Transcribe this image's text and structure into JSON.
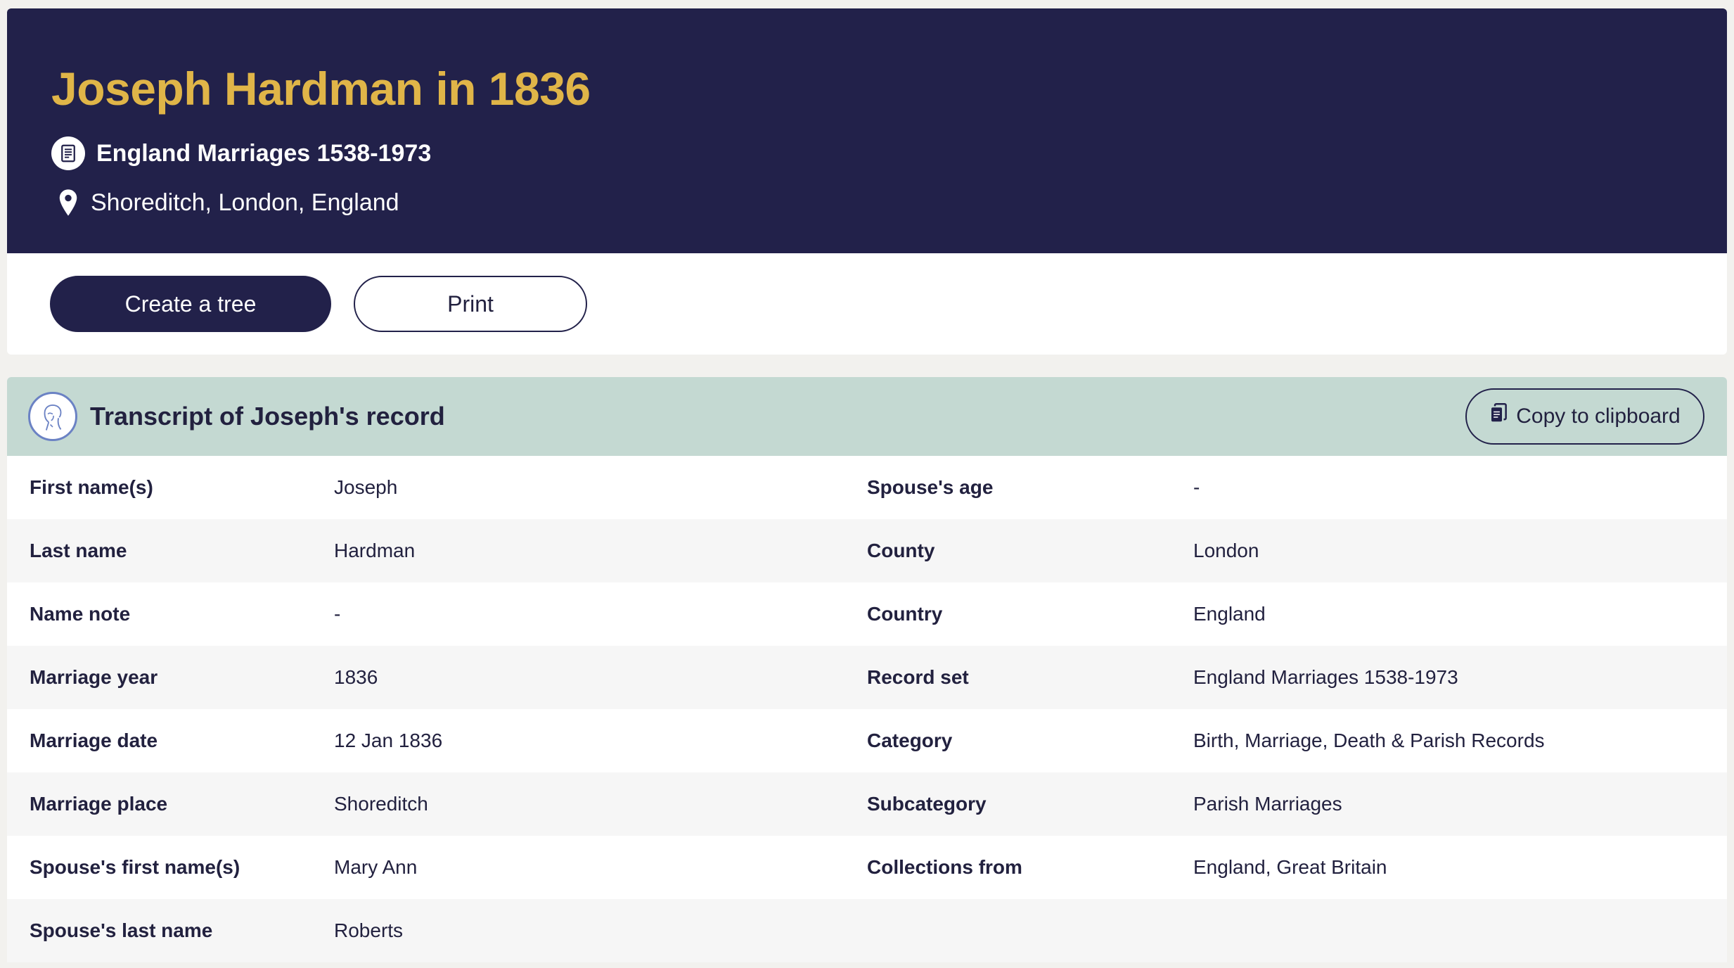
{
  "header": {
    "title": "Joseph Hardman in 1836",
    "record_set": "England Marriages 1538-1973",
    "location": "Shoreditch, London, England",
    "colors": {
      "background": "#22214a",
      "title": "#e0b548"
    }
  },
  "actions": {
    "create_tree": "Create a tree",
    "print": "Print"
  },
  "transcript": {
    "title": "Transcript of Joseph's record",
    "copy_label": "Copy to clipboard",
    "header_color": "#c4d9d2",
    "rows": [
      {
        "label_left": "First name(s)",
        "value_left": "Joseph",
        "label_right": "Spouse's age",
        "value_right": "-"
      },
      {
        "label_left": "Last name",
        "value_left": "Hardman",
        "label_right": "County",
        "value_right": "London"
      },
      {
        "label_left": "Name note",
        "value_left": "-",
        "label_right": "Country",
        "value_right": "England"
      },
      {
        "label_left": "Marriage year",
        "value_left": "1836",
        "label_right": "Record set",
        "value_right": "England Marriages 1538-1973"
      },
      {
        "label_left": "Marriage date",
        "value_left": "12 Jan 1836",
        "label_right": "Category",
        "value_right": "Birth, Marriage, Death & Parish Records"
      },
      {
        "label_left": "Marriage place",
        "value_left": "Shoreditch",
        "label_right": "Subcategory",
        "value_right": "Parish Marriages"
      },
      {
        "label_left": "Spouse's first name(s)",
        "value_left": "Mary Ann",
        "label_right": "Collections from",
        "value_right": "England, Great Britain"
      },
      {
        "label_left": "Spouse's last name",
        "value_left": "Roberts",
        "label_right": "",
        "value_right": ""
      }
    ]
  },
  "icons": {
    "record_set": "document-icon",
    "location": "map-pin-icon",
    "transcript": "person-portrait-icon",
    "copy": "copy-icon"
  }
}
